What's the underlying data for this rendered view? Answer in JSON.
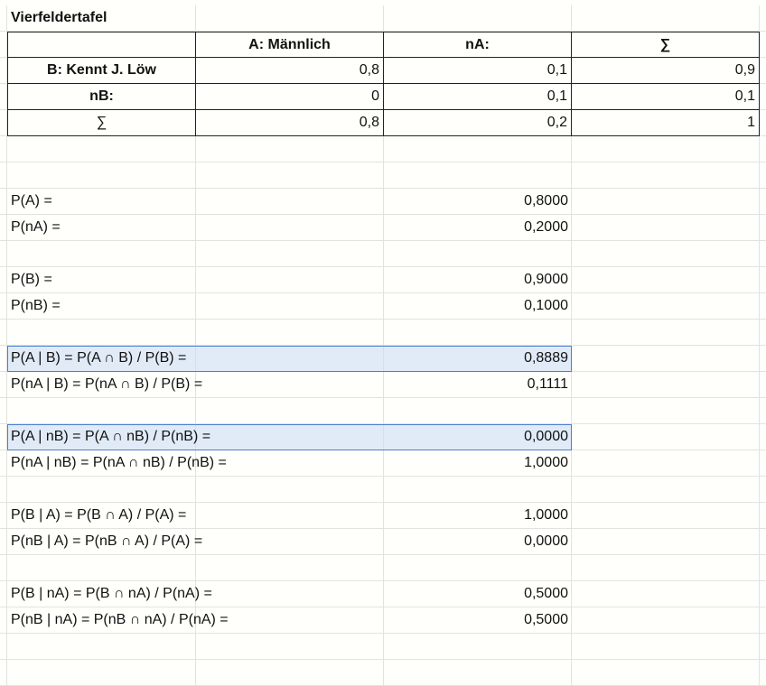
{
  "sheet": {
    "title": "Vierfeldertafel",
    "table": {
      "header": [
        "",
        "A: Männlich",
        "nA:",
        "∑"
      ],
      "rows": [
        {
          "label": "B: Kennt J. Löw",
          "values": [
            "0,8",
            "0,1",
            "0,9"
          ]
        },
        {
          "label": "nB:",
          "values": [
            "0",
            "0,1",
            "0,1"
          ]
        },
        {
          "label": "∑",
          "values": [
            "0,8",
            "0,2",
            "1"
          ]
        }
      ]
    },
    "calculations": [
      {
        "label": "P(A) =",
        "value": "0,8000",
        "highlight": false
      },
      {
        "label": "P(nA) =",
        "value": "0,2000",
        "highlight": false
      },
      {
        "label": "P(B) =",
        "value": "0,9000",
        "highlight": false
      },
      {
        "label": "P(nB) =",
        "value": "0,1000",
        "highlight": false
      },
      {
        "label": "P(A | B) = P(A ∩ B) / P(B) =",
        "value": "0,8889",
        "highlight": true
      },
      {
        "label": "P(nA | B) = P(nA ∩ B) / P(B) =",
        "value": "0,1111",
        "highlight": false
      },
      {
        "label": "P(A | nB) = P(A ∩ nB) / P(nB) =",
        "value": "0,0000",
        "highlight": true
      },
      {
        "label": "P(nA | nB) = P(nA ∩ nB) / P(nB) =",
        "value": "1,0000",
        "highlight": false
      },
      {
        "label": "P(B | A) = P(B ∩ A) / P(A) =",
        "value": "1,0000",
        "highlight": false
      },
      {
        "label": "P(nB | A) = P(nB ∩ A) / P(A) =",
        "value": "0,0000",
        "highlight": false
      },
      {
        "label": "P(B | nA) = P(B ∩ nA) / P(nA) =",
        "value": "0,5000",
        "highlight": false
      },
      {
        "label": "P(nB | nA) = P(nB ∩ nA) / P(nA) =",
        "value": "0,5000",
        "highlight": false
      }
    ],
    "colors": {
      "highlight_fill": "#dbe7f8",
      "highlight_border": "#4a7fd4",
      "gridline": "#e2e2e2",
      "table_border": "#222222",
      "background": "#fffffb"
    }
  }
}
